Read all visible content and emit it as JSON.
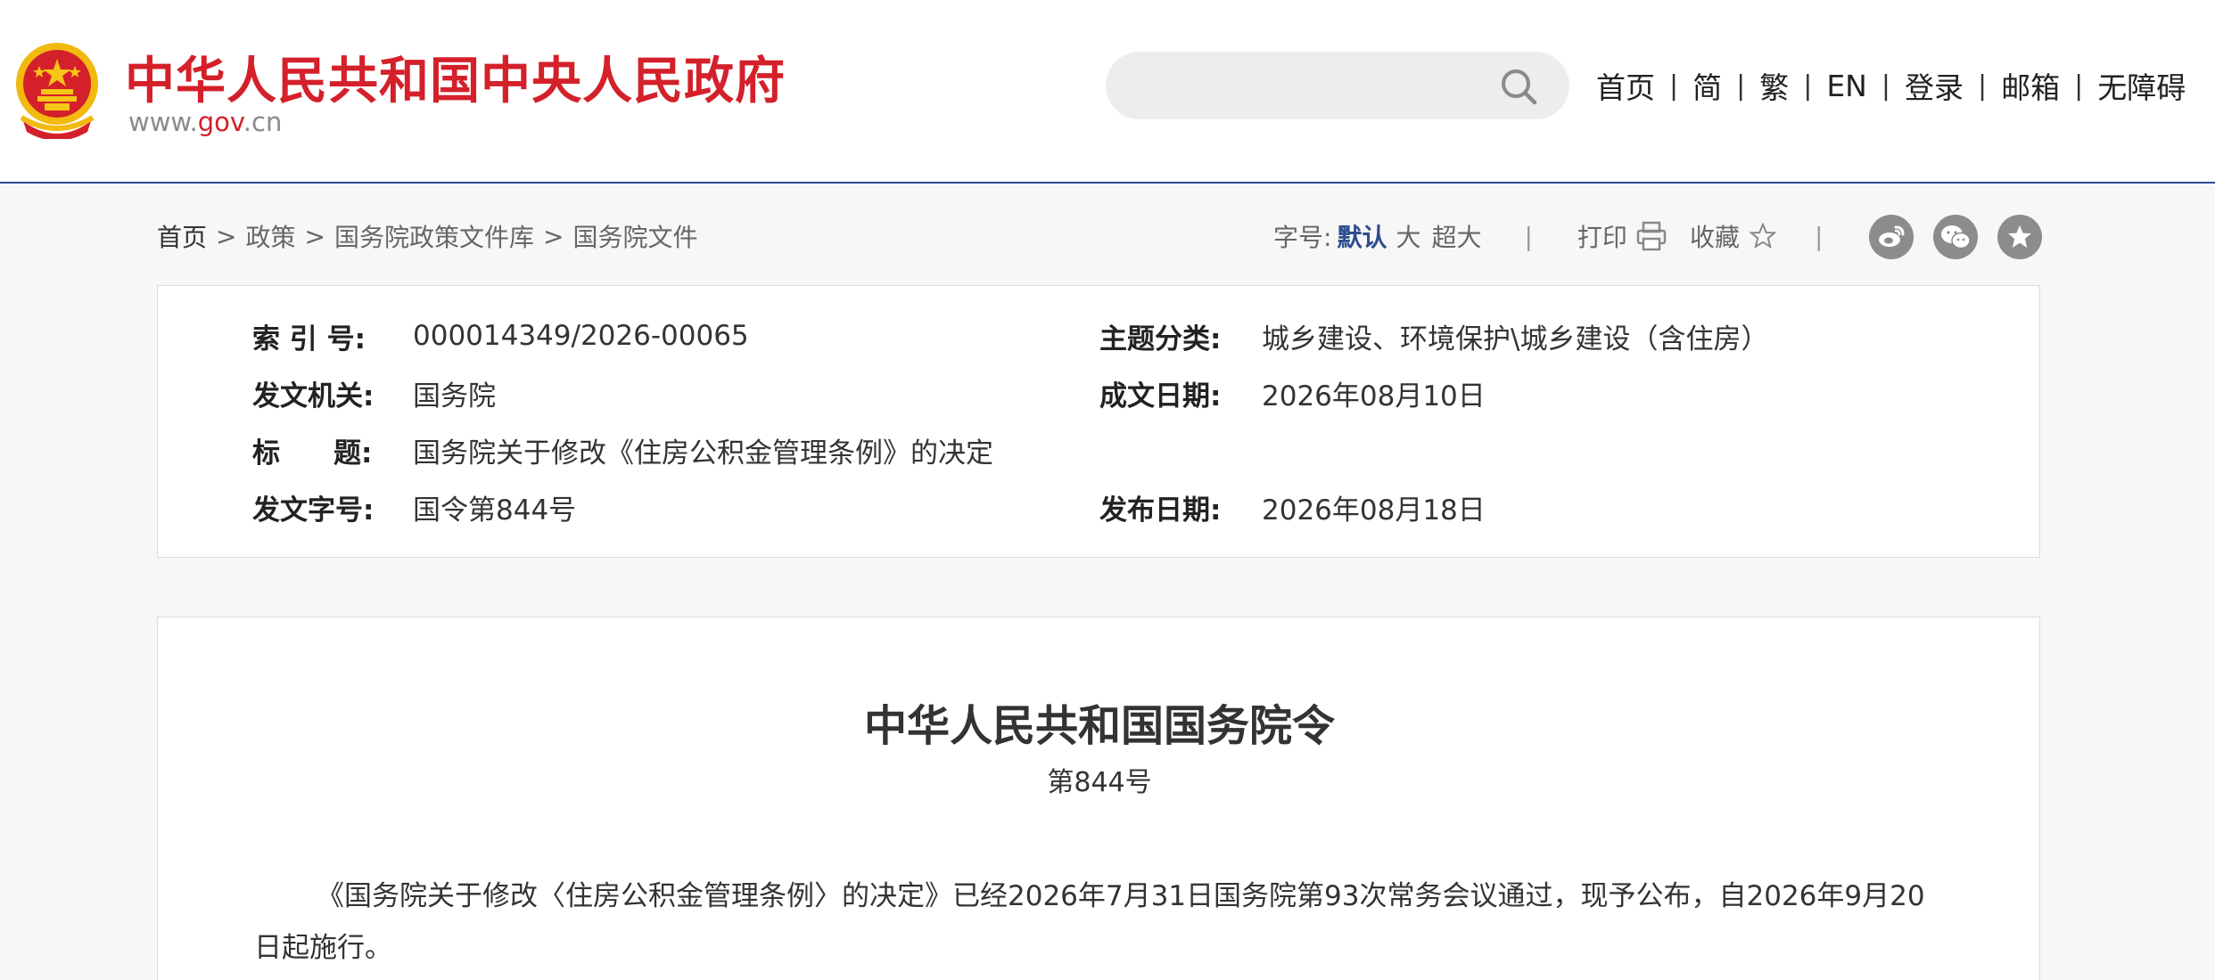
{
  "header": {
    "site_title": "中华人民共和国中央人民政府",
    "domain_prefix": "www.",
    "domain_gov": "gov",
    "domain_suffix": ".cn",
    "emblem_icon": "national-emblem-icon",
    "search": {
      "placeholder": "",
      "icon": "search-icon"
    },
    "nav": [
      "首页",
      "简",
      "繁",
      "EN",
      "登录",
      "邮箱",
      "无障碍"
    ],
    "nav_separator": "|"
  },
  "breadcrumb": {
    "items": [
      "首页",
      "政策",
      "国务院政策文件库",
      "国务院文件"
    ],
    "separator": ">"
  },
  "tools": {
    "font_size_label": "字号:",
    "font_default": "默认",
    "font_big": "大",
    "font_huge": "超大",
    "separator": "|",
    "print_label": "打印",
    "favorite_label": "收藏",
    "share_icons": [
      "weibo-icon",
      "wechat-icon",
      "favorite-star-icon"
    ]
  },
  "metadata": {
    "index_label": "索 引 号:",
    "index_value": "000014349/2026-00065",
    "topic_label": "主题分类:",
    "topic_value": "城乡建设、环境保护\\城乡建设（含住房）",
    "issuer_label": "发文机关:",
    "issuer_value": "国务院",
    "written_label": "成文日期:",
    "written_value": "2026年08月10日",
    "title_label_a": "标",
    "title_label_b": "题:",
    "title_value": "国务院关于修改《住房公积金管理条例》的决定",
    "docno_label": "发文字号:",
    "docno_value": "国令第844号",
    "published_label": "发布日期:",
    "published_value": "2026年08月18日"
  },
  "document": {
    "title": "中华人民共和国国务院令",
    "number": "第844号",
    "paragraph": "《国务院关于修改〈住房公积金管理条例〉的决定》已经2026年7月31日国务院第93次常务会议通过，现予公布，自2026年9月20日起施行。"
  },
  "colors": {
    "brand_red": "#d4202a",
    "accent_blue": "#2e4d8f",
    "share_gray": "#8c8c8c"
  }
}
